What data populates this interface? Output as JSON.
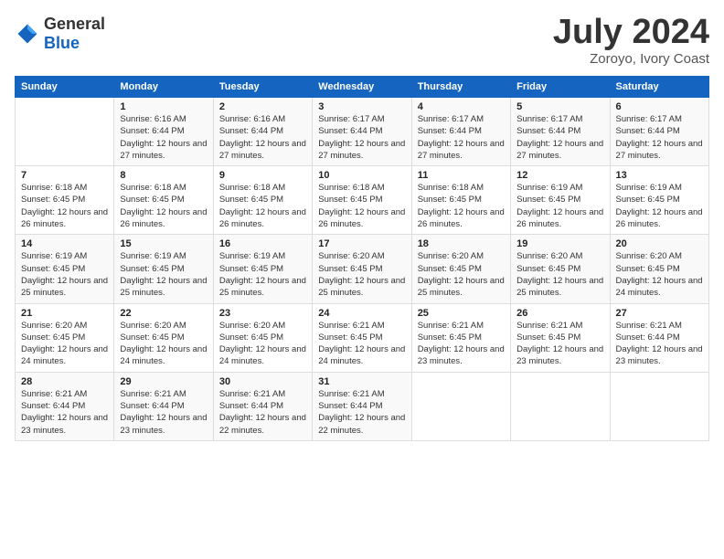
{
  "logo": {
    "text_general": "General",
    "text_blue": "Blue"
  },
  "title": "July 2024",
  "location": "Zoroyo, Ivory Coast",
  "days_of_week": [
    "Sunday",
    "Monday",
    "Tuesday",
    "Wednesday",
    "Thursday",
    "Friday",
    "Saturday"
  ],
  "weeks": [
    [
      {
        "day": "",
        "sunrise": "",
        "sunset": "",
        "daylight": ""
      },
      {
        "day": "1",
        "sunrise": "Sunrise: 6:16 AM",
        "sunset": "Sunset: 6:44 PM",
        "daylight": "Daylight: 12 hours and 27 minutes."
      },
      {
        "day": "2",
        "sunrise": "Sunrise: 6:16 AM",
        "sunset": "Sunset: 6:44 PM",
        "daylight": "Daylight: 12 hours and 27 minutes."
      },
      {
        "day": "3",
        "sunrise": "Sunrise: 6:17 AM",
        "sunset": "Sunset: 6:44 PM",
        "daylight": "Daylight: 12 hours and 27 minutes."
      },
      {
        "day": "4",
        "sunrise": "Sunrise: 6:17 AM",
        "sunset": "Sunset: 6:44 PM",
        "daylight": "Daylight: 12 hours and 27 minutes."
      },
      {
        "day": "5",
        "sunrise": "Sunrise: 6:17 AM",
        "sunset": "Sunset: 6:44 PM",
        "daylight": "Daylight: 12 hours and 27 minutes."
      },
      {
        "day": "6",
        "sunrise": "Sunrise: 6:17 AM",
        "sunset": "Sunset: 6:44 PM",
        "daylight": "Daylight: 12 hours and 27 minutes."
      }
    ],
    [
      {
        "day": "7",
        "sunrise": "Sunrise: 6:18 AM",
        "sunset": "Sunset: 6:45 PM",
        "daylight": "Daylight: 12 hours and 26 minutes."
      },
      {
        "day": "8",
        "sunrise": "Sunrise: 6:18 AM",
        "sunset": "Sunset: 6:45 PM",
        "daylight": "Daylight: 12 hours and 26 minutes."
      },
      {
        "day": "9",
        "sunrise": "Sunrise: 6:18 AM",
        "sunset": "Sunset: 6:45 PM",
        "daylight": "Daylight: 12 hours and 26 minutes."
      },
      {
        "day": "10",
        "sunrise": "Sunrise: 6:18 AM",
        "sunset": "Sunset: 6:45 PM",
        "daylight": "Daylight: 12 hours and 26 minutes."
      },
      {
        "day": "11",
        "sunrise": "Sunrise: 6:18 AM",
        "sunset": "Sunset: 6:45 PM",
        "daylight": "Daylight: 12 hours and 26 minutes."
      },
      {
        "day": "12",
        "sunrise": "Sunrise: 6:19 AM",
        "sunset": "Sunset: 6:45 PM",
        "daylight": "Daylight: 12 hours and 26 minutes."
      },
      {
        "day": "13",
        "sunrise": "Sunrise: 6:19 AM",
        "sunset": "Sunset: 6:45 PM",
        "daylight": "Daylight: 12 hours and 26 minutes."
      }
    ],
    [
      {
        "day": "14",
        "sunrise": "Sunrise: 6:19 AM",
        "sunset": "Sunset: 6:45 PM",
        "daylight": "Daylight: 12 hours and 25 minutes."
      },
      {
        "day": "15",
        "sunrise": "Sunrise: 6:19 AM",
        "sunset": "Sunset: 6:45 PM",
        "daylight": "Daylight: 12 hours and 25 minutes."
      },
      {
        "day": "16",
        "sunrise": "Sunrise: 6:19 AM",
        "sunset": "Sunset: 6:45 PM",
        "daylight": "Daylight: 12 hours and 25 minutes."
      },
      {
        "day": "17",
        "sunrise": "Sunrise: 6:20 AM",
        "sunset": "Sunset: 6:45 PM",
        "daylight": "Daylight: 12 hours and 25 minutes."
      },
      {
        "day": "18",
        "sunrise": "Sunrise: 6:20 AM",
        "sunset": "Sunset: 6:45 PM",
        "daylight": "Daylight: 12 hours and 25 minutes."
      },
      {
        "day": "19",
        "sunrise": "Sunrise: 6:20 AM",
        "sunset": "Sunset: 6:45 PM",
        "daylight": "Daylight: 12 hours and 25 minutes."
      },
      {
        "day": "20",
        "sunrise": "Sunrise: 6:20 AM",
        "sunset": "Sunset: 6:45 PM",
        "daylight": "Daylight: 12 hours and 24 minutes."
      }
    ],
    [
      {
        "day": "21",
        "sunrise": "Sunrise: 6:20 AM",
        "sunset": "Sunset: 6:45 PM",
        "daylight": "Daylight: 12 hours and 24 minutes."
      },
      {
        "day": "22",
        "sunrise": "Sunrise: 6:20 AM",
        "sunset": "Sunset: 6:45 PM",
        "daylight": "Daylight: 12 hours and 24 minutes."
      },
      {
        "day": "23",
        "sunrise": "Sunrise: 6:20 AM",
        "sunset": "Sunset: 6:45 PM",
        "daylight": "Daylight: 12 hours and 24 minutes."
      },
      {
        "day": "24",
        "sunrise": "Sunrise: 6:21 AM",
        "sunset": "Sunset: 6:45 PM",
        "daylight": "Daylight: 12 hours and 24 minutes."
      },
      {
        "day": "25",
        "sunrise": "Sunrise: 6:21 AM",
        "sunset": "Sunset: 6:45 PM",
        "daylight": "Daylight: 12 hours and 23 minutes."
      },
      {
        "day": "26",
        "sunrise": "Sunrise: 6:21 AM",
        "sunset": "Sunset: 6:45 PM",
        "daylight": "Daylight: 12 hours and 23 minutes."
      },
      {
        "day": "27",
        "sunrise": "Sunrise: 6:21 AM",
        "sunset": "Sunset: 6:44 PM",
        "daylight": "Daylight: 12 hours and 23 minutes."
      }
    ],
    [
      {
        "day": "28",
        "sunrise": "Sunrise: 6:21 AM",
        "sunset": "Sunset: 6:44 PM",
        "daylight": "Daylight: 12 hours and 23 minutes."
      },
      {
        "day": "29",
        "sunrise": "Sunrise: 6:21 AM",
        "sunset": "Sunset: 6:44 PM",
        "daylight": "Daylight: 12 hours and 23 minutes."
      },
      {
        "day": "30",
        "sunrise": "Sunrise: 6:21 AM",
        "sunset": "Sunset: 6:44 PM",
        "daylight": "Daylight: 12 hours and 22 minutes."
      },
      {
        "day": "31",
        "sunrise": "Sunrise: 6:21 AM",
        "sunset": "Sunset: 6:44 PM",
        "daylight": "Daylight: 12 hours and 22 minutes."
      },
      {
        "day": "",
        "sunrise": "",
        "sunset": "",
        "daylight": ""
      },
      {
        "day": "",
        "sunrise": "",
        "sunset": "",
        "daylight": ""
      },
      {
        "day": "",
        "sunrise": "",
        "sunset": "",
        "daylight": ""
      }
    ]
  ]
}
